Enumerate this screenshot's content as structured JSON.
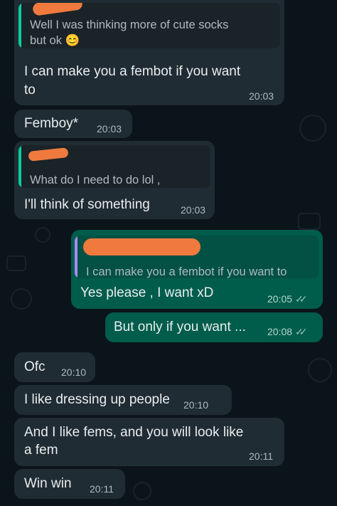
{
  "messages": [
    {
      "quote": {
        "line1": "Well I was thinking more of cute socks",
        "line2": "but ok",
        "emoji": "😊"
      },
      "line1": "I can make you a fembot if you want",
      "line2": "to",
      "time": "20:03"
    },
    {
      "text": "Femboy*",
      "time": "20:03"
    },
    {
      "quote": {
        "line1": "What do I need to do lol ,"
      },
      "text": "I'll think of something",
      "time": "20:03"
    },
    {
      "quote": {
        "line1": "I can make you a fembot if you want to"
      },
      "text": "Yes please , I want xD",
      "time": "20:05"
    },
    {
      "text": "But only if you want ...",
      "time": "20:08"
    },
    {
      "text": "Ofc",
      "time": "20:10"
    },
    {
      "text": "I like dressing up people",
      "time": "20:10"
    },
    {
      "line1": "And I like fems, and you will look like",
      "line2": "a fem",
      "time": "20:11"
    },
    {
      "text": "Win win",
      "time": "20:11"
    }
  ],
  "read_ticks": "✓✓",
  "colors": {
    "background": "#0b141a",
    "incoming": "#202c33",
    "outgoing": "#005c4b",
    "quote_bar_in": "#06cf9c",
    "quote_bar_out": "#a78bfa",
    "redaction": "#f07a3e"
  }
}
